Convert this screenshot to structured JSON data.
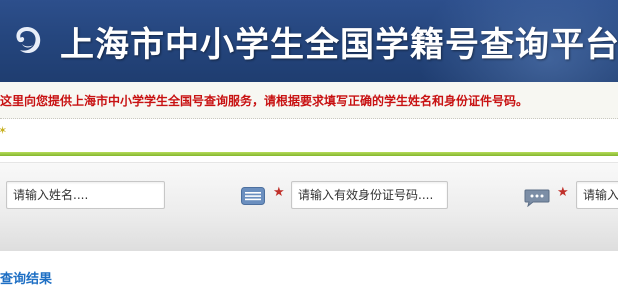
{
  "header": {
    "title": "上海市中小学生全国学籍号查询平台",
    "logo_icon": "shanghai-emblem-icon"
  },
  "notice": {
    "text": "这里向您提供上海市中小学学生全国号查询服务，请根据要求填写正确的学生姓名和身份证件号码。"
  },
  "form": {
    "name_placeholder": "请输入姓名....",
    "id_placeholder": "请输入有效身份证号码....",
    "code_placeholder": "请输入",
    "required_marker": "★",
    "id_icon": "id-card-icon",
    "code_icon": "chat-bubble-icon"
  },
  "results": {
    "title": "查询结果"
  },
  "colors": {
    "header_bg": "#25467e",
    "notice_text": "#c81212",
    "accent_green": "#84b62e",
    "link_blue": "#1e6fc4",
    "required_star": "#c0302a"
  }
}
